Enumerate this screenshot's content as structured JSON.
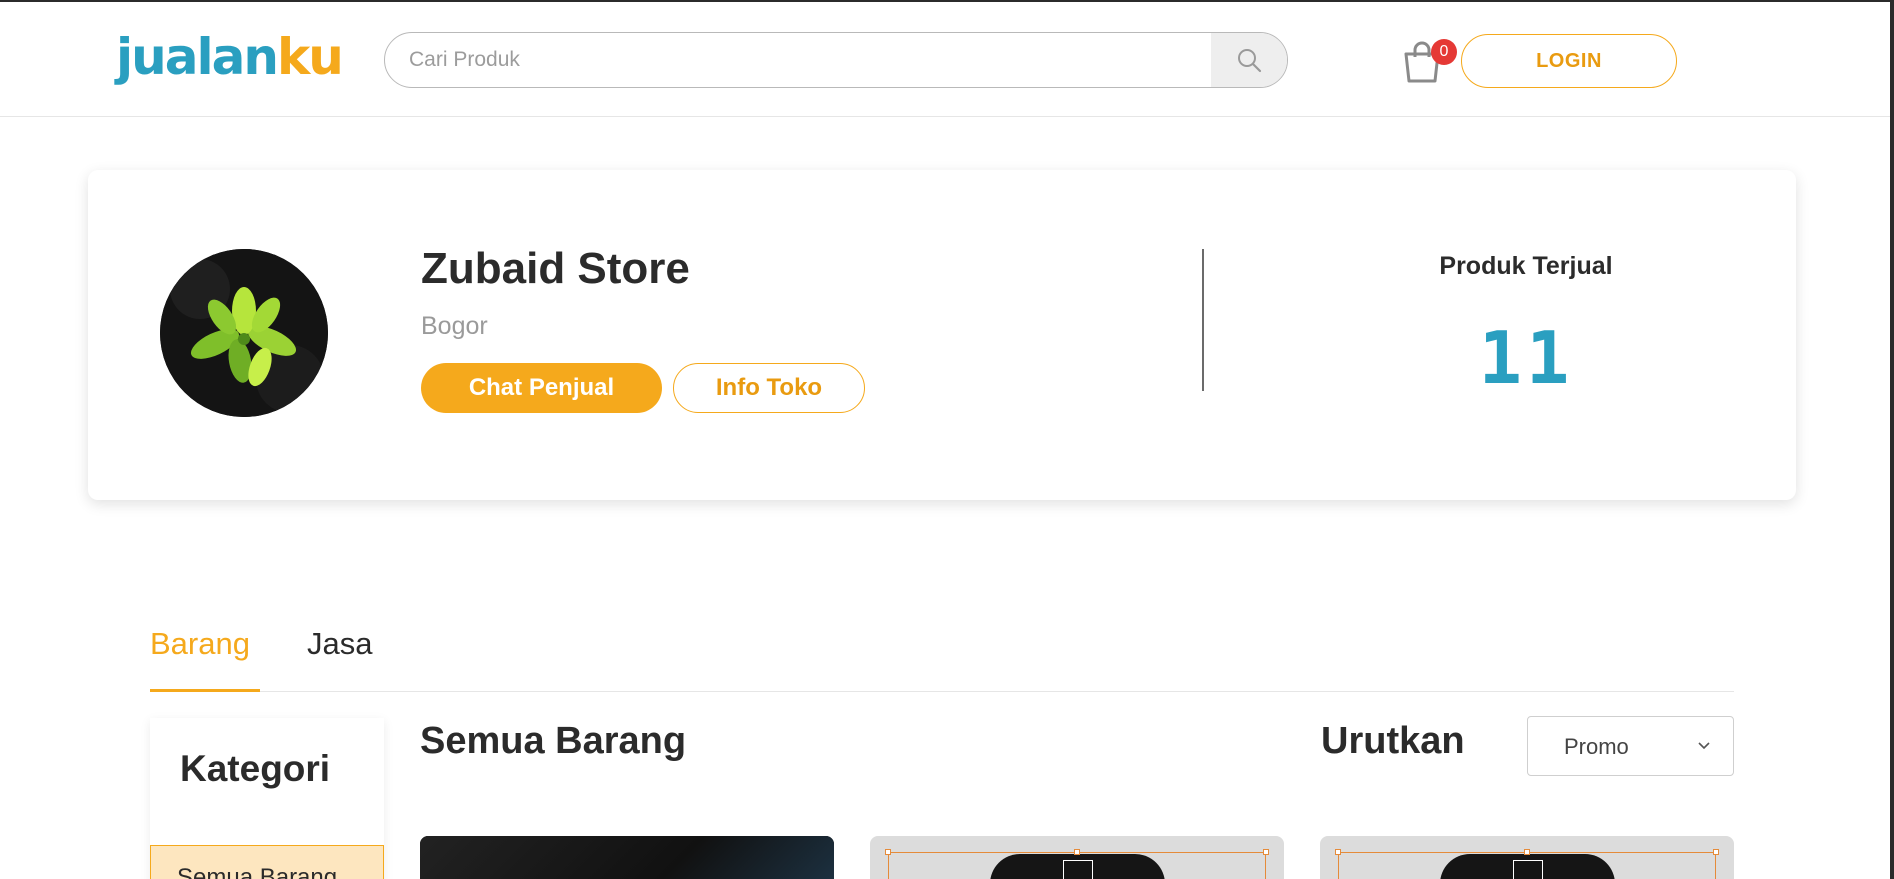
{
  "header": {
    "logo_part1": "jualan",
    "logo_part2": "ku",
    "search_placeholder": "Cari Produk",
    "search_icon": "search-icon",
    "cart_icon": "shopping-bag-icon",
    "cart_count": "0",
    "login_label": "LOGIN"
  },
  "store": {
    "name": "Zubaid Store",
    "city": "Bogor",
    "chat_button": "Chat Penjual",
    "info_button": "Info Toko",
    "sold_label": "Produk Terjual",
    "sold_value": "11"
  },
  "tabs": {
    "items": [
      {
        "label": "Barang",
        "active": true
      },
      {
        "label": "Jasa",
        "active": false
      }
    ]
  },
  "sidebar": {
    "title": "Kategori",
    "items": [
      {
        "label": "Semua Barang",
        "active": true
      }
    ]
  },
  "products": {
    "title": "Semua Barang",
    "sort_label": "Urutkan",
    "sort_value": "Promo",
    "sort_icon": "chevron-down-icon"
  },
  "colors": {
    "brand_blue": "#2a9fc0",
    "brand_orange": "#f5a91c",
    "badge_red": "#e53935"
  }
}
